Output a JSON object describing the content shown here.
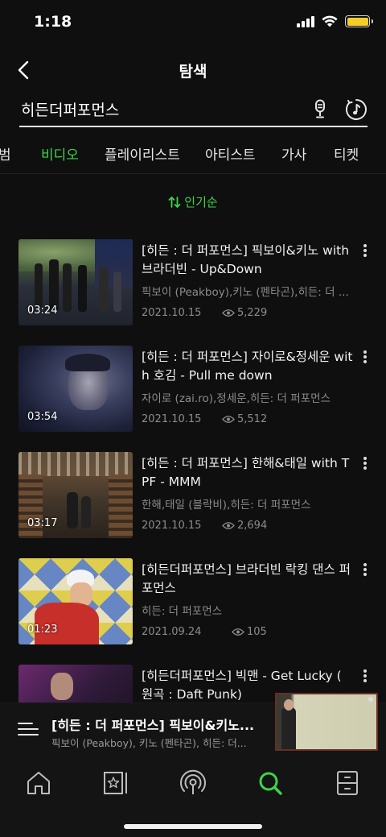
{
  "status_bar": {
    "time": "1:18"
  },
  "header": {
    "title": "탐색"
  },
  "search": {
    "query": "히든더퍼포먼스"
  },
  "tabs": [
    {
      "label": "범",
      "active": false
    },
    {
      "label": "비디오",
      "active": true
    },
    {
      "label": "플레이리스트",
      "active": false
    },
    {
      "label": "아티스트",
      "active": false
    },
    {
      "label": "가사",
      "active": false
    },
    {
      "label": "티켓",
      "active": false
    }
  ],
  "sort": {
    "label": "인기순"
  },
  "videos": [
    {
      "title": "[히든 : 더 퍼포먼스] 픽보이&키노 with 브라더빈 - Up&Down",
      "artist": "픽보이 (Peakboy),키노 (펜타곤),히든: 더 ...",
      "date": "2021.10.15",
      "views": "5,229",
      "duration": "03:24"
    },
    {
      "title": "[히든 : 더 퍼포먼스] 자이로&정세운 with 호김 - Pull me down",
      "artist": "자이로 (zai.ro),정세운,히든: 더 퍼포먼스",
      "date": "2021.10.15",
      "views": "5,512",
      "duration": "03:54"
    },
    {
      "title": "[히든 : 더 퍼포먼스] 한해&태일 with TPF - MMM",
      "artist": "한해,태일 (블락비),히든: 더 퍼포먼스",
      "date": "2021.10.15",
      "views": "2,694",
      "duration": "03:17"
    },
    {
      "title": "[히든더퍼포먼스] 브라더빈 락킹 댄스 퍼포먼스",
      "artist": "히든: 더 퍼포먼스",
      "date": "2021.09.24",
      "views": "105",
      "duration": "01:23"
    },
    {
      "title": "[히든더퍼포먼스] 빅맨 - Get Lucky ( 원곡 : Daft Punk)",
      "artist": "",
      "date": "",
      "views": "",
      "duration": ""
    }
  ],
  "mini_player": {
    "title": "[히든 : 더 퍼포먼스] 픽보이&키노...",
    "artist": "픽보이 (Peakboy), 키노 (펜타곤), 히든: 더..."
  },
  "nav": [
    {
      "icon": "home-icon"
    },
    {
      "icon": "library-icon"
    },
    {
      "icon": "podcast-icon"
    },
    {
      "icon": "search-icon",
      "active": true
    },
    {
      "icon": "storage-icon"
    }
  ],
  "colors": {
    "accent": "#3fd34a",
    "background": "#0f0f0f"
  }
}
